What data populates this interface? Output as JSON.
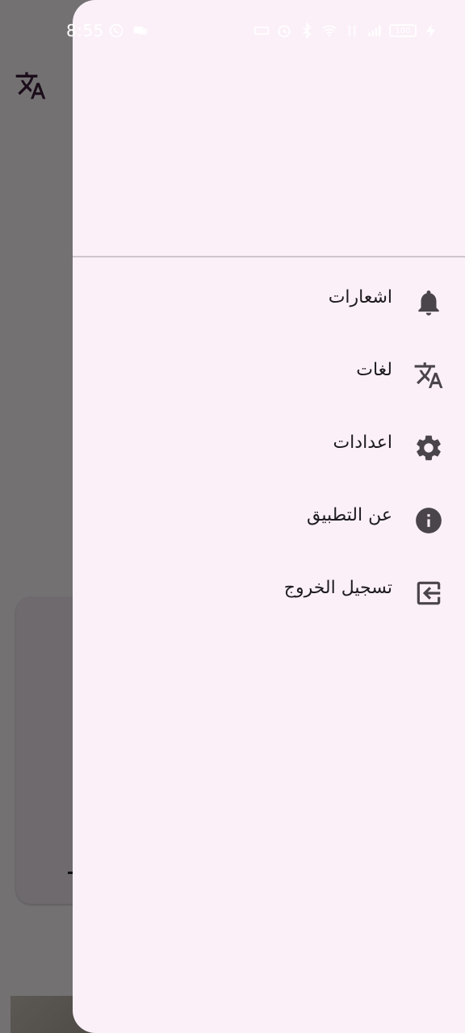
{
  "status_bar": {
    "time": "8:55",
    "battery_level": "100"
  },
  "menu": {
    "items": [
      {
        "label": "اشعارات",
        "icon": "bell-icon"
      },
      {
        "label": "لغات",
        "icon": "translate-icon"
      },
      {
        "label": "اعدادات",
        "icon": "gear-icon"
      },
      {
        "label": "عن التطبيق",
        "icon": "info-icon"
      },
      {
        "label": "تسجيل الخروج",
        "icon": "logout-icon"
      }
    ]
  },
  "colors": {
    "drawer_background": "#fbf0f8",
    "scrim": "#000000",
    "icon": "#4a444b",
    "text": "#1d1b1e",
    "divider": "#cdc6cd"
  }
}
